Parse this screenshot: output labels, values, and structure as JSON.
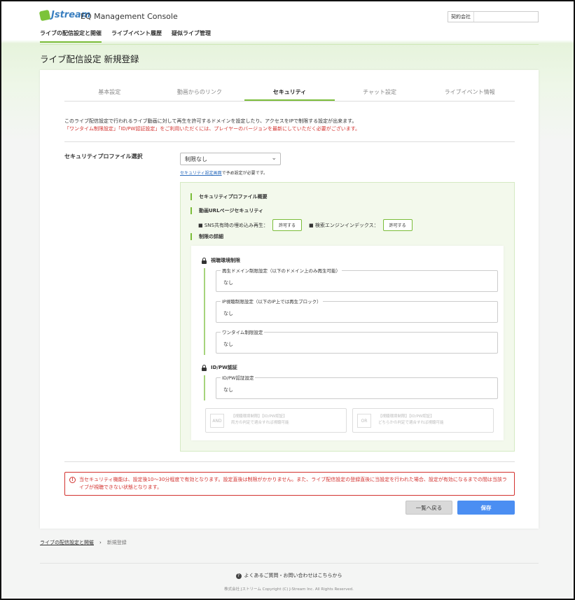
{
  "app": {
    "logo_text": "Jstream",
    "title": "EQ Management Console",
    "contract_label": "契約会社",
    "contract_value": ""
  },
  "nav": {
    "items": [
      {
        "label": "ライブの配信設定と開催"
      },
      {
        "label": "ライブイベント履歴"
      },
      {
        "label": "疑似ライブ管理"
      }
    ]
  },
  "page": {
    "title": "ライブ配信設定 新規登録"
  },
  "tabs": [
    {
      "label": "基本設定"
    },
    {
      "label": "動画からのリンク"
    },
    {
      "label": "セキュリティ"
    },
    {
      "label": "チャット設定"
    },
    {
      "label": "ライブイベント情報"
    }
  ],
  "intro": {
    "line1": "このライブ配信設定で行われるライブ動画に対して再生を許可するドメインを設定したり、アクセスをIPで制限する設定が出来ます。",
    "line2": "「ワンタイム制限設定」「ID/PW認証設定」をご利用いただくには、プレイヤーのバージョンを最新にしていただく必要がございます。"
  },
  "security": {
    "profile_label": "セキュリティプロファイル選択",
    "profile_selected": "制限なし",
    "note_link": "セキュリティ設定画面",
    "note_rest": "で予め設定が必要です。"
  },
  "summary": {
    "title": "セキュリティプロファイル概要",
    "url_section": "動画URLページセキュリティ",
    "sns_label": "■ SNS共有時の埋め込み再生：",
    "sns_value": "許可する",
    "search_label": "■ 検索エンジンインデックス：",
    "search_value": "許可する",
    "detail_section": "制限の詳細",
    "env_title": "視聴環境制限",
    "domain_legend": "再生ドメイン制限設定（以下のドメイン上のみ再生可能）",
    "domain_value": "なし",
    "ip_legend": "IP視聴制限設定（以下のIP上では再生ブロック）",
    "ip_value": "なし",
    "onetime_legend": "ワンタイム制限設定",
    "onetime_value": "なし",
    "idpw_title": "ID/PW認証",
    "idpw_legend": "ID/PW認証設定",
    "idpw_value": "なし",
    "and_badge": "AND",
    "and_line1": "【視聴環境制限】【ID/PW認証】",
    "and_line2": "両方の判定で適合すれば視聴可能",
    "or_badge": "OR",
    "or_line1": "【視聴環境制限】【ID/PW認証】",
    "or_line2": "どちらかの判定で適合すれば視聴可能"
  },
  "alert": {
    "icon": "!",
    "text": "当セキュリティ機能は、設定後10〜30分程度で有効となります。設定直後は制限がかかりません。また、ライブ配信設定の登録直後に当設定を行われた場合、設定が有効になるまでの間は当該ライブが視聴できない状態となります。"
  },
  "buttons": {
    "back": "一覧へ戻る",
    "save": "保存"
  },
  "breadcrumb": {
    "parent": "ライブの配信設定と開催",
    "separator": "›",
    "current": "新規登録"
  },
  "footer": {
    "faq_icon": "?",
    "faq": "よくあるご質問・お問い合わせはこちらから",
    "copyright": "株式会社 Jストリーム Copyright (C) J-Stream Inc. All Rights Reserved."
  },
  "colors": {
    "accent_green": "#7bbd3a",
    "primary_blue": "#4b8ef2",
    "alert_red": "#d3322f"
  }
}
